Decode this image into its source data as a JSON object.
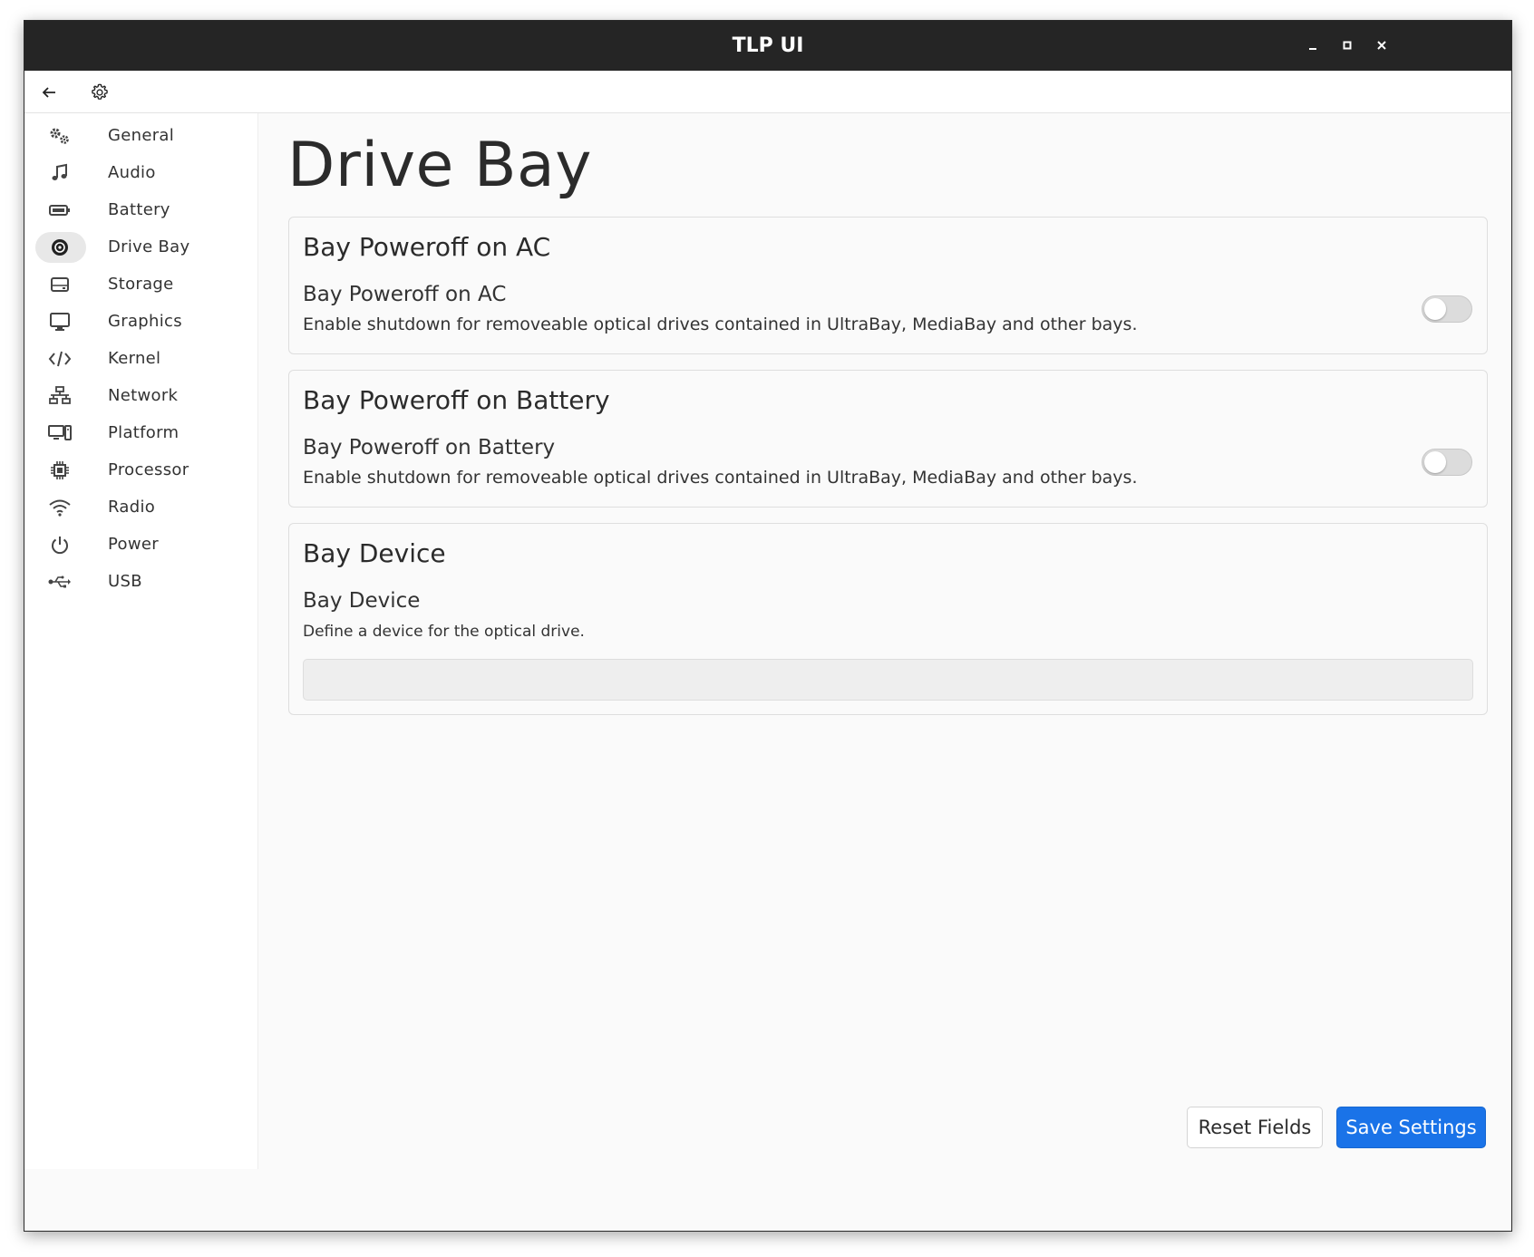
{
  "window": {
    "title": "TLP UI"
  },
  "sidebar": {
    "items": [
      {
        "label": "General",
        "icon": "gears-icon"
      },
      {
        "label": "Audio",
        "icon": "music-note-icon"
      },
      {
        "label": "Battery",
        "icon": "battery-icon"
      },
      {
        "label": "Drive Bay",
        "icon": "optical-disc-icon",
        "active": true
      },
      {
        "label": "Storage",
        "icon": "hard-drive-icon"
      },
      {
        "label": "Graphics",
        "icon": "monitor-icon"
      },
      {
        "label": "Kernel",
        "icon": "code-icon"
      },
      {
        "label": "Network",
        "icon": "network-icon"
      },
      {
        "label": "Platform",
        "icon": "computer-tower-icon"
      },
      {
        "label": "Processor",
        "icon": "cpu-chip-icon"
      },
      {
        "label": "Radio",
        "icon": "wifi-icon"
      },
      {
        "label": "Power",
        "icon": "power-icon"
      },
      {
        "label": "USB",
        "icon": "usb-icon"
      }
    ]
  },
  "page": {
    "title": "Drive Bay"
  },
  "cards": {
    "ac": {
      "title": "Bay Poweroff on AC",
      "label": "Bay Poweroff on AC",
      "description": "Enable shutdown for removeable optical drives contained in UltraBay, MediaBay and other bays.",
      "enabled": false
    },
    "battery": {
      "title": "Bay Poweroff on Battery",
      "label": "Bay Poweroff on Battery",
      "description": "Enable shutdown for removeable optical drives contained in UltraBay, MediaBay and other bays.",
      "enabled": false
    },
    "device": {
      "title": "Bay Device",
      "label": "Bay Device",
      "description": "Define a device for the optical drive.",
      "value": ""
    }
  },
  "footer": {
    "reset_label": "Reset Fields",
    "save_label": "Save Settings"
  },
  "colors": {
    "accent": "#1a73e8",
    "titlebar": "#252525"
  }
}
